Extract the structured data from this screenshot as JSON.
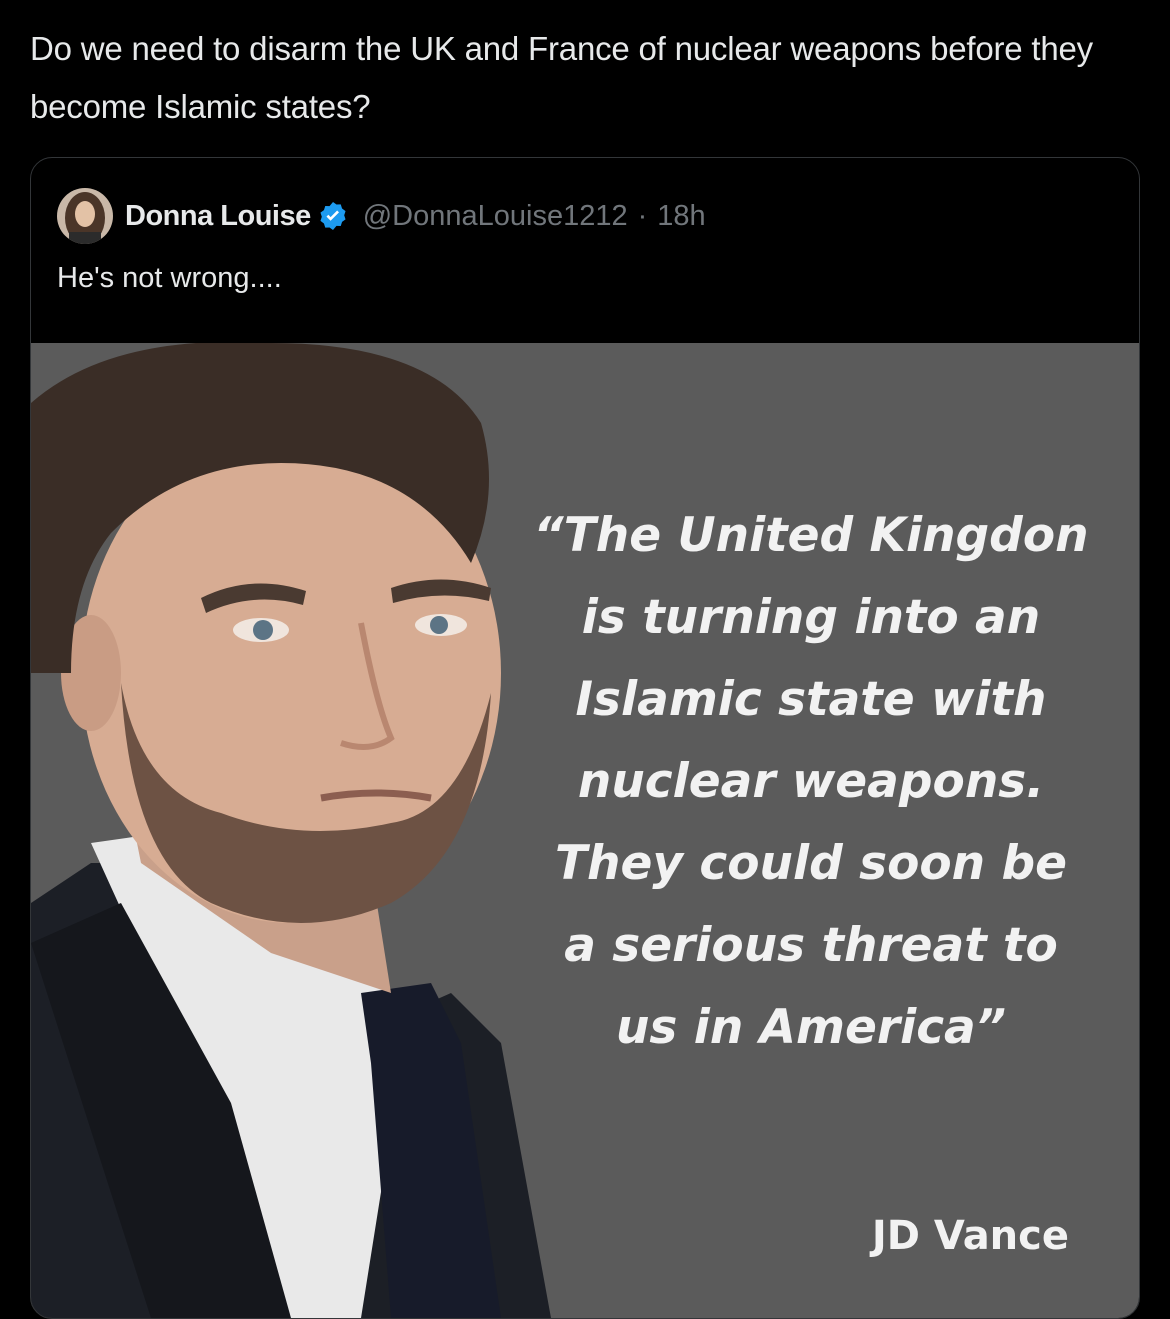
{
  "post": {
    "text": "Do we need to disarm the UK and France of nuclear weapons before they become Islamic states?"
  },
  "quoted_post": {
    "author_name": "Donna Louise",
    "handle": "@DonnaLouise1212",
    "separator": "·",
    "time": "18h",
    "text": "He's not wrong....",
    "verified_color": "#1d9bf0",
    "image": {
      "quote": "“The  United Kingdon is turning into an Islamic state with nuclear weapons. They could soon be a serious threat to us in America”",
      "attribution": "JD Vance",
      "background_color": "#5b5b5b"
    }
  },
  "icons": {
    "verified": "verified-badge-icon",
    "avatar": "avatar-image"
  }
}
